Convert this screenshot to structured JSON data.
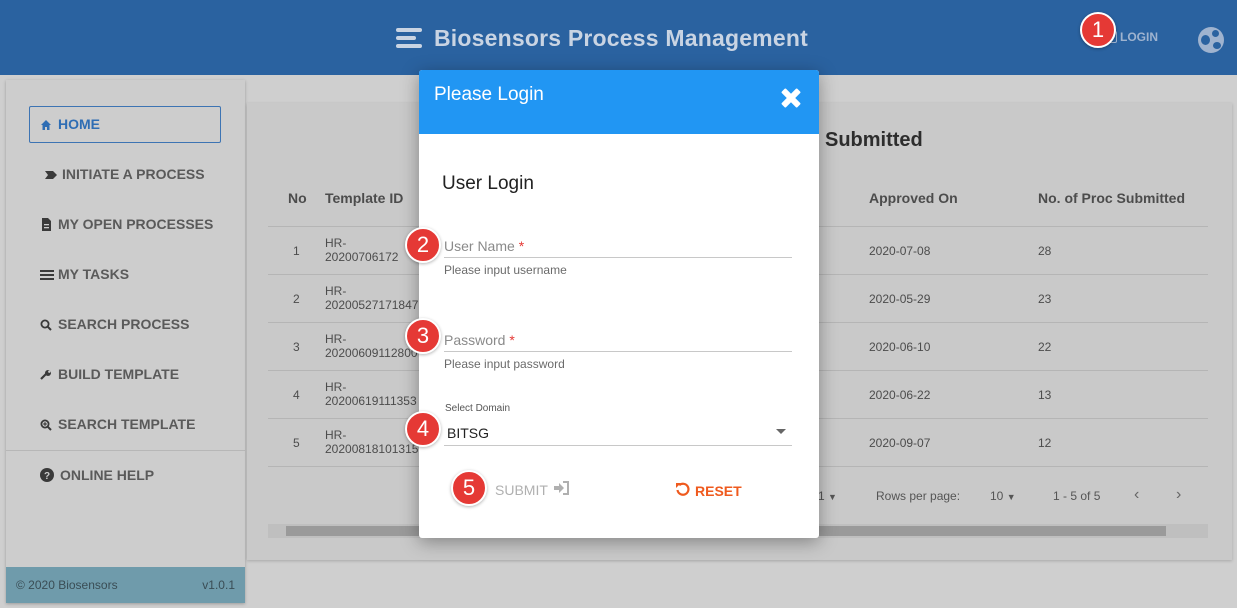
{
  "header": {
    "title": "Biosensors Process Management",
    "login_label": "LOGIN"
  },
  "sidebar": {
    "items": [
      {
        "label": "HOME",
        "icon": "home-icon"
      },
      {
        "label": "INITIATE A PROCESS",
        "icon": "arrow-tag-icon"
      },
      {
        "label": "MY OPEN PROCESSES",
        "icon": "document-icon"
      },
      {
        "label": "MY TASKS",
        "icon": "tasks-list-icon"
      },
      {
        "label": "SEARCH PROCESS",
        "icon": "search-icon"
      },
      {
        "label": "BUILD TEMPLATE",
        "icon": "wrench-icon"
      },
      {
        "label": "SEARCH TEMPLATE",
        "icon": "search-plus-icon"
      },
      {
        "label": "ONLINE HELP",
        "icon": "question-circle-icon"
      }
    ],
    "footer_copyright": "© 2020 Biosensors",
    "footer_version": "v1.0.1"
  },
  "main": {
    "title": "Submitted",
    "columns": {
      "no": "No",
      "template_id": "Template ID",
      "approved_on": "Approved On",
      "proc_submitted": "No. of Proc Submitted"
    },
    "rows": [
      {
        "no": "1",
        "tid_a": "HR-",
        "tid_b": "20200706172",
        "approved": "2020-07-08",
        "count": "28"
      },
      {
        "no": "2",
        "tid_a": "HR-",
        "tid_b": "20200527171847",
        "approved": "2020-05-29",
        "count": "23"
      },
      {
        "no": "3",
        "tid_a": "HR-",
        "tid_b": "20200609112800",
        "approved": "2020-06-10",
        "count": "22"
      },
      {
        "no": "4",
        "tid_a": "HR-",
        "tid_b": "20200619111353",
        "approved": "2020-06-22",
        "count": "13"
      },
      {
        "no": "5",
        "tid_a": "HR-",
        "tid_b": "20200818101315",
        "approved": "2020-09-07",
        "count": "12"
      }
    ],
    "pager": {
      "page": "1",
      "rows_per_page_label": "Rows per page:",
      "rows_per_page_value": "10",
      "range": "1 - 5 of 5"
    }
  },
  "modal": {
    "title": "Please Login",
    "subtitle": "User Login",
    "username_label": "User Name",
    "username_hint": "Please input username",
    "password_label": "Password",
    "password_hint": "Please input password",
    "required_mark": "*",
    "domain_label": "Select Domain",
    "domain_value": "BITSG",
    "submit_label": "SUBMIT",
    "reset_label": "RESET"
  },
  "callouts": [
    "1",
    "2",
    "3",
    "4",
    "5"
  ],
  "colors": {
    "header": "#2a62a0",
    "modal_header": "#2196f3",
    "accent_reset": "#ef5a1e",
    "callout": "#e53935"
  }
}
